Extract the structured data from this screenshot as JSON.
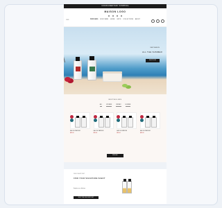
{
  "header": {
    "announcement": "COMPLIMENTARY SHIPPING",
    "logo": "MAISON LOGO",
    "currency": "USD",
    "nav": [
      "PERFUMES",
      "BODYCARE",
      "HOME",
      "GIFTS",
      "COLLECTIONS",
      "ABOUT"
    ]
  },
  "hero": {
    "eyebrow": "NEW SEASON",
    "title": "ALL THE SUMMER",
    "cta": "SHOP NOW"
  },
  "bestsellers": {
    "title": "BESTSELLERS",
    "tabs": [
      "ALL",
      "WOMEN",
      "UNISEX",
      "HOMME"
    ],
    "products": [
      {
        "name": "EAU DE PARFUM",
        "price": "$85.00"
      },
      {
        "name": "EAU DE PARFUM",
        "price": "$85.00"
      },
      {
        "name": "EAU DE PARFUM",
        "price": "$85.00"
      },
      {
        "name": "EAU DE PARFUM",
        "price": "$85.00"
      }
    ],
    "cta": "VIEW ALL"
  },
  "promo": {
    "eyebrow": "DISCOVERY SET",
    "title": "FIND YOUR SIGNATURE SCENT",
    "text": "Explore our collection",
    "cta": "SHOP THE DISCOVERY SET"
  },
  "colors": {
    "accent_red": "#b22a2a",
    "accent_teal": "#1f6b7a",
    "dark": "#1b1b1b"
  }
}
